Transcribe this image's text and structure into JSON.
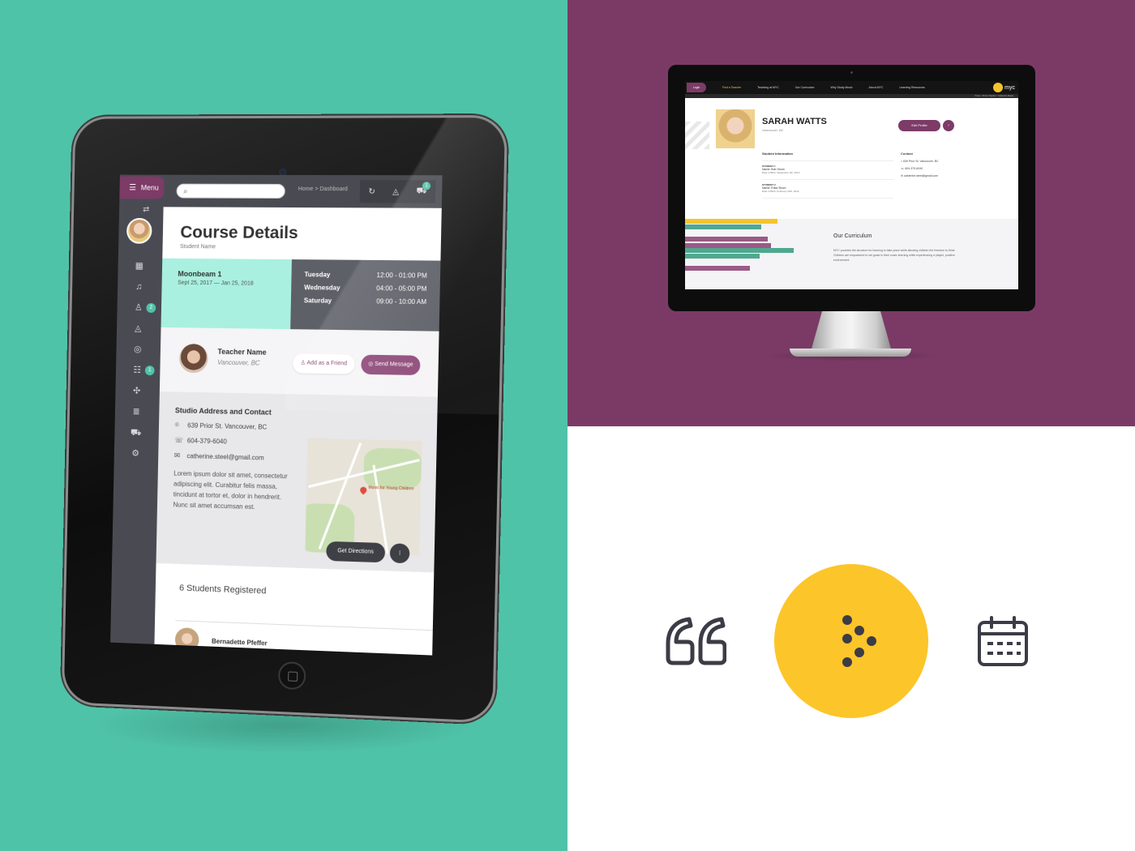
{
  "ipad_app": {
    "menu_label": "Menu",
    "search_placeholder": "",
    "breadcrumb": [
      "Home",
      ">",
      "Dashboard"
    ],
    "sidebar_badges": [
      "2",
      "1"
    ],
    "cart_badge": "1",
    "page_title": "Course Details",
    "page_subtitle": "Student Name",
    "course": {
      "name": "Moonbeam 1",
      "start": "Sept 25, 2017",
      "separator": "—",
      "end": "Jan 25, 2018",
      "schedule": [
        {
          "day": "Tuesday",
          "time": "12:00 - 01:00 PM"
        },
        {
          "day": "Wednesday",
          "time": "04:00 - 05:00 PM"
        },
        {
          "day": "Saturday",
          "time": "09:00 - 10:00 AM"
        }
      ]
    },
    "teacher": {
      "name": "Teacher Name",
      "location": "Vancouver, BC",
      "add_friend_label": "Add as a Friend",
      "send_message_label": "Send Message"
    },
    "studio": {
      "heading": "Studio Address and Contact",
      "address": "639 Prior St. Vancouver, BC",
      "phone": "604-379-6040",
      "email": "catherine.steel@gmail.com",
      "description": "Lorem ipsum dolor sit amet, consectetur adipiscing elit. Curabitur felis massa, tincidunt at tortor et, dolor in hendrerit. Nunc sit amet accumsan est.",
      "map_label": "Music for Young Children",
      "directions_label": "Get Directions"
    },
    "students": {
      "count_label": "6 Students Registered",
      "first_name": "Bernadette Pfeffer"
    }
  },
  "desktop_site": {
    "nav": {
      "login": "Login",
      "items": [
        "Find a Teacher",
        "Teaching at MYC",
        "Our Curriculum",
        "Why Study Music",
        "About MYC",
        "Learning Resources"
      ],
      "logo_text": "myc"
    },
    "breadcrumb": "Home > Find a Teacher > Catherine Steele",
    "profile": {
      "name": "SARAH WATTS",
      "location": "Vancouver, BC",
      "edit_label": "Edit Profile"
    },
    "student_info": {
      "heading": "Student Information",
      "students": [
        {
          "label": "STUDENT 1",
          "name": "Name: Bob Shum",
          "dob": "Date of Birth: September 4th, 2010"
        },
        {
          "label": "STUDENT 2",
          "name": "Name: Erika Shum",
          "dob": "Date of Birth: February 23rd, 2012"
        }
      ]
    },
    "contact": {
      "heading": "Contact",
      "address": "639 Prior St. Vancouver, BC",
      "phone": "604-379-6040",
      "email": "catherine.steel@gmail.com"
    },
    "curriculum": {
      "title": "Our Curriculum",
      "text": "MYC provides the structure for learning to take place while allowing children the freedom to think. Children are empowered to set goals in their music learning while experiencing a playful, positive environment."
    }
  },
  "icons": [
    "quote-icon",
    "myc-dots-icon",
    "calendar-icon"
  ],
  "colors": {
    "teal": "#4fc3a8",
    "purple": "#7b3a66",
    "yellow": "#fcc529",
    "dark": "#3c3c46"
  }
}
